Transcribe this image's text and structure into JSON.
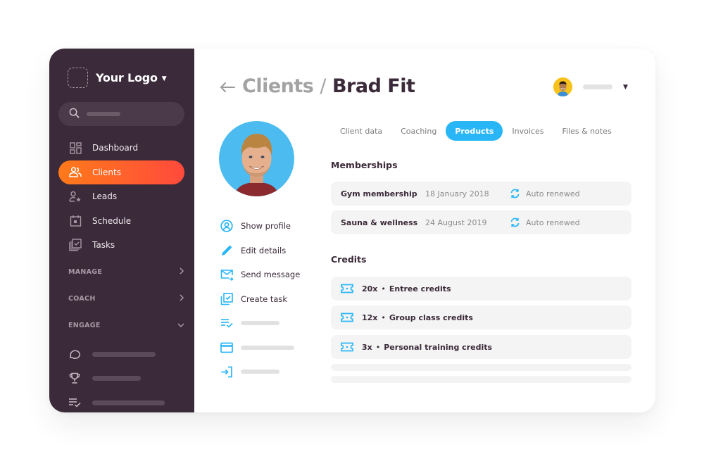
{
  "sidebar": {
    "logo_text": "Your Logo",
    "search_placeholder": "",
    "nav": [
      {
        "label": "Dashboard",
        "icon": "dashboard-icon",
        "active": false
      },
      {
        "label": "Clients",
        "icon": "clients-icon",
        "active": true
      },
      {
        "label": "Leads",
        "icon": "leads-icon",
        "active": false
      },
      {
        "label": "Schedule",
        "icon": "calendar-icon",
        "active": false
      },
      {
        "label": "Tasks",
        "icon": "tasks-icon",
        "active": false
      }
    ],
    "sections": [
      {
        "label": "MANAGE",
        "expanded": false
      },
      {
        "label": "COACH",
        "expanded": false
      },
      {
        "label": "ENGAGE",
        "expanded": true
      }
    ],
    "engage_items": [
      {
        "icon": "chat-bubble-icon"
      },
      {
        "icon": "trophy-icon"
      },
      {
        "icon": "checklist-icon"
      }
    ],
    "colors": {
      "background": "#3b2a39",
      "active_gradient_start": "#ff7a1a",
      "active_gradient_end": "#ff4a3c"
    }
  },
  "header": {
    "back_icon": "arrow-left-icon",
    "breadcrumb_parent": "Clients",
    "breadcrumb_separator": "/",
    "breadcrumb_current": "Brad Fit"
  },
  "user_menu": {
    "avatar": "user-avatar",
    "caret_icon": "caret-down-icon"
  },
  "profile": {
    "photo": "client-photo",
    "actions": [
      {
        "label": "Show profile",
        "icon": "user-circle-icon"
      },
      {
        "label": "Edit details",
        "icon": "pencil-icon"
      },
      {
        "label": "Send message",
        "icon": "mail-send-icon"
      },
      {
        "label": "Create task",
        "icon": "task-check-icon"
      },
      {
        "label": "",
        "icon": "checklist-icon"
      },
      {
        "label": "",
        "icon": "credit-card-icon"
      },
      {
        "label": "",
        "icon": "sign-in-icon"
      }
    ]
  },
  "tabs": [
    {
      "label": "Client data",
      "active": false
    },
    {
      "label": "Coaching",
      "active": false
    },
    {
      "label": "Products",
      "active": true
    },
    {
      "label": "Invoices",
      "active": false
    },
    {
      "label": "Files & notes",
      "active": false
    }
  ],
  "memberships": {
    "title": "Memberships",
    "items": [
      {
        "name": "Gym membership",
        "date": "18 January 2018",
        "status": "Auto renewed"
      },
      {
        "name": "Sauna & wellness",
        "date": "24 August 2019",
        "status": "Auto renewed"
      }
    ]
  },
  "credits": {
    "title": "Credits",
    "items": [
      {
        "count": "20x",
        "name": "Entree credits"
      },
      {
        "count": "12x",
        "name": "Group class credits"
      },
      {
        "count": "3x",
        "name": "Personal training credits"
      }
    ]
  },
  "accent_color": "#29b6f6"
}
